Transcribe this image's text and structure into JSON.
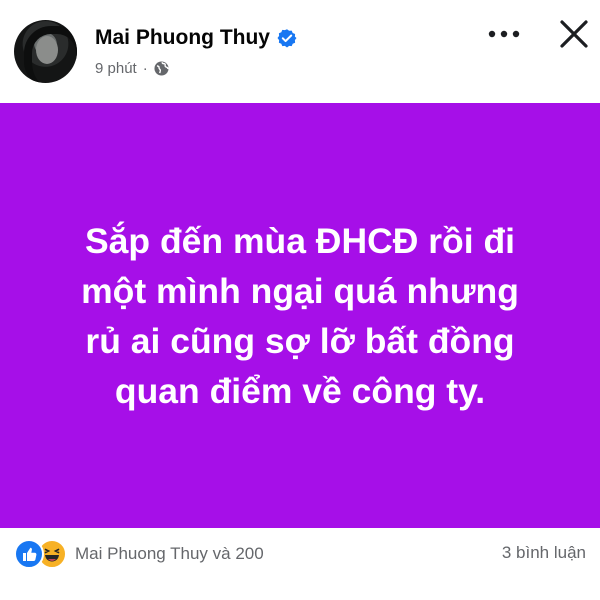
{
  "post": {
    "author": "Mai Phuong Thuy",
    "time": "9 phút",
    "privacy_icon": "globe-icon",
    "verified_icon": "verified-badge-icon",
    "background_color": "#a60fe8",
    "text_lines": [
      "Sắp đến mùa ĐHCĐ rồi đi",
      "một mình ngại quá nhưng",
      "rủ ai cũng sợ lỡ bất đồng",
      "quan điểm về công ty."
    ]
  },
  "header": {
    "more_icon": "more-options-icon",
    "close_icon": "close-icon"
  },
  "footer": {
    "reactions_text": "Mai Phuong Thuy và 200",
    "comments_text": "3 bình luận",
    "reaction_icons": [
      "like-icon",
      "haha-icon"
    ]
  }
}
